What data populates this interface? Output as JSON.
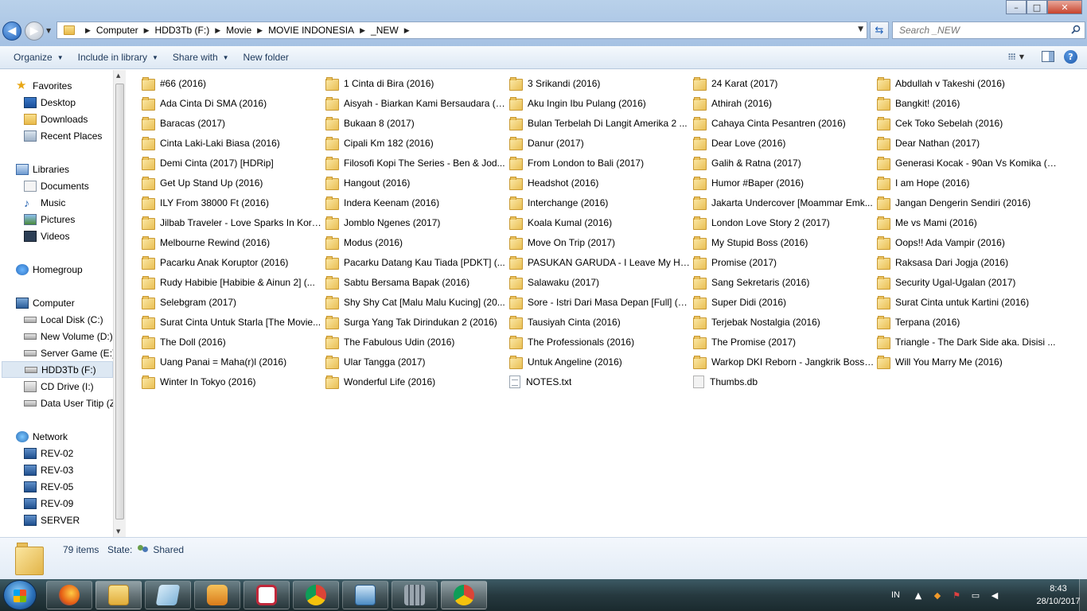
{
  "window": {
    "controls": {
      "minimize": "–",
      "maximize": "□",
      "close": "✕"
    }
  },
  "address": {
    "crumbs": [
      "Computer",
      "HDD3Tb (F:)",
      "Movie",
      "MOVIE INDONESIA",
      "_NEW"
    ]
  },
  "search": {
    "placeholder": "Search _NEW"
  },
  "toolbar": {
    "organize": "Organize",
    "include": "Include in library",
    "share": "Share with",
    "new_folder": "New folder"
  },
  "nav": {
    "favorites": "Favorites",
    "desktop": "Desktop",
    "downloads": "Downloads",
    "recent": "Recent Places",
    "libraries": "Libraries",
    "documents": "Documents",
    "music": "Music",
    "pictures": "Pictures",
    "videos": "Videos",
    "homegroup": "Homegroup",
    "computer": "Computer",
    "local_c": "Local Disk (C:)",
    "new_d": "New Volume (D:)",
    "server_e": "Server Game (E:)",
    "hdd_f": "HDD3Tb (F:)",
    "cd_i": "CD Drive (I:)",
    "data_user": "Data User Titip (Z",
    "network": "Network",
    "rev02": "REV-02",
    "rev03": "REV-03",
    "rev05": "REV-05",
    "rev09": "REV-09",
    "server": "SERVER"
  },
  "files": [
    [
      "#66 (2016)",
      "1 Cinta di Bira (2016)",
      "3 Srikandi (2016)",
      "24 Karat (2017)",
      "Abdullah v Takeshi (2016)"
    ],
    [
      "Ada Cinta Di SMA (2016)",
      "Aisyah - Biarkan Kami Bersaudara (2...",
      "Aku Ingin Ibu Pulang (2016)",
      "Athirah (2016)",
      "Bangkit! (2016)"
    ],
    [
      "Baracas (2017)",
      "Bukaan 8 (2017)",
      "Bulan Terbelah Di Langit Amerika 2 ...",
      "Cahaya Cinta Pesantren (2016)",
      "Cek Toko Sebelah (2016)"
    ],
    [
      "Cinta Laki-Laki Biasa (2016)",
      "Cipali Km 182 (2016)",
      "Danur (2017)",
      "Dear Love (2016)",
      "Dear Nathan (2017)"
    ],
    [
      "Demi Cinta (2017) [HDRip]",
      "Filosofi Kopi The Series - Ben & Jod...",
      "From London to Bali (2017)",
      "Galih & Ratna (2017)",
      "Generasi Kocak - 90an Vs Komika (2..."
    ],
    [
      "Get Up Stand Up (2016)",
      "Hangout (2016)",
      "Headshot (2016)",
      "Humor #Baper (2016)",
      "I am Hope (2016)"
    ],
    [
      "ILY From 38000 Ft (2016)",
      "Indera Keenam (2016)",
      "Interchange (2016)",
      "Jakarta Undercover [Moammar Emk...",
      "Jangan Dengerin Sendiri (2016)"
    ],
    [
      "Jilbab Traveler - Love Sparks In Kore...",
      "Jomblo Ngenes (2017)",
      "Koala Kumal (2016)",
      "London Love Story 2 (2017)",
      "Me vs Mami (2016)"
    ],
    [
      "Melbourne Rewind (2016)",
      "Modus (2016)",
      "Move On Trip (2017)",
      "My Stupid Boss (2016)",
      "Oops!! Ada Vampir (2016)"
    ],
    [
      "Pacarku Anak Koruptor (2016)",
      "Pacarku Datang Kau Tiada [PDKT] (...",
      "PASUKAN GARUDA - I Leave My He...",
      "Promise (2017)",
      "Raksasa Dari Jogja (2016)"
    ],
    [
      "Rudy Habibie [Habibie & Ainun 2] (...",
      "Sabtu Bersama Bapak (2016)",
      "Salawaku (2017)",
      "Sang Sekretaris (2016)",
      "Security Ugal-Ugalan (2017)"
    ],
    [
      "Selebgram (2017)",
      "Shy Shy Cat [Malu Malu Kucing] (20...",
      "Sore - Istri Dari Masa Depan [Full] (2...",
      "Super Didi (2016)",
      "Surat Cinta untuk Kartini (2016)"
    ],
    [
      "Surat Cinta Untuk Starla [The Movie...",
      "Surga Yang Tak Dirindukan 2 (2016)",
      "Tausiyah Cinta (2016)",
      "Terjebak Nostalgia (2016)",
      "Terpana (2016)"
    ],
    [
      "The Doll (2016)",
      "The Fabulous Udin (2016)",
      "The Professionals (2016)",
      "The Promise (2017)",
      "Triangle - The Dark Side aka. Disisi ..."
    ],
    [
      "Uang Panai = Maha(r)l (2016)",
      "Ular Tangga (2017)",
      "Untuk Angeline (2016)",
      "Warkop DKI Reborn - Jangkrik Boss!...",
      "Will You Marry Me (2016)"
    ],
    [
      "Winter In Tokyo (2016)",
      "Wonderful Life (2016)",
      "NOTES.txt",
      "Thumbs.db",
      ""
    ]
  ],
  "details": {
    "count": "79 items",
    "state_label": "State:",
    "state_value": "Shared"
  },
  "tray": {
    "lang": "IN",
    "time": "8:43",
    "date": "28/10/2017"
  }
}
